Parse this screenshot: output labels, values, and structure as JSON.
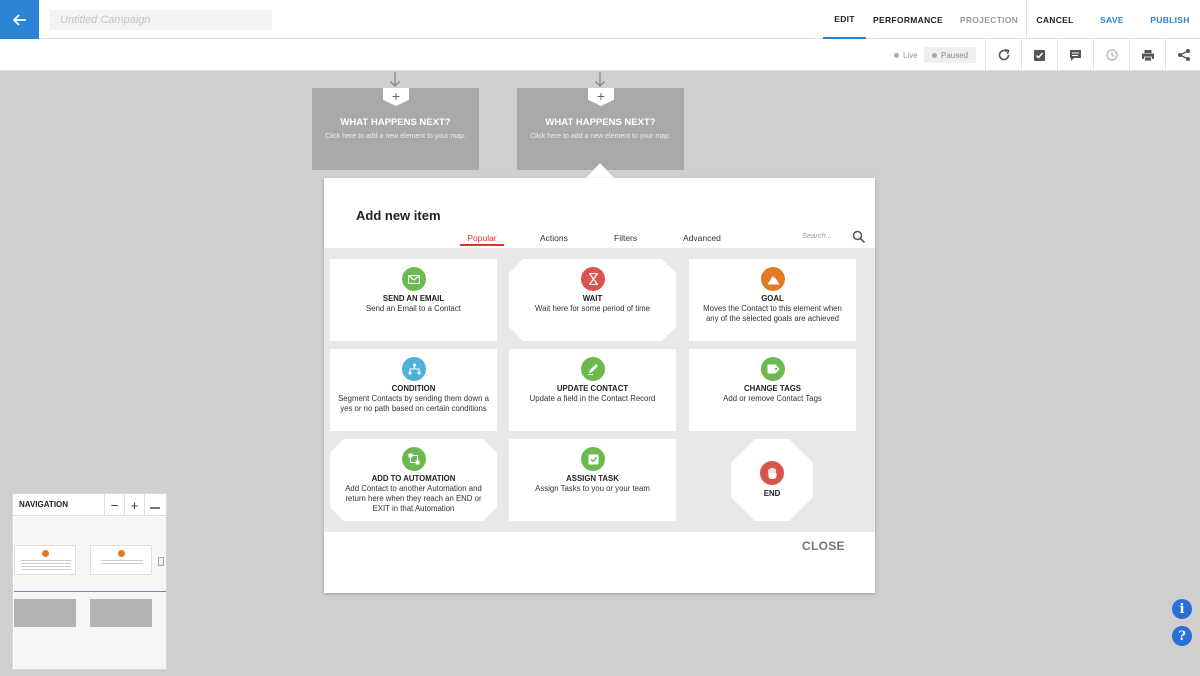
{
  "header": {
    "title_placeholder": "Untitled Campaign",
    "nav": {
      "edit": "EDIT",
      "performance": "PERFORMANCE",
      "projection": "PROJECTION",
      "cancel": "CANCEL",
      "save": "SAVE",
      "publish": "PUBLISH"
    },
    "accent_color": "#2b83d6"
  },
  "toolbar": {
    "status_live": "Live",
    "status_paused": "Paused",
    "icons": [
      "refresh-icon",
      "checklist-icon",
      "notes-icon",
      "history-icon",
      "print-icon",
      "share-icon"
    ]
  },
  "canvas": {
    "nodes": [
      {
        "title": "WHAT HAPPENS NEXT?",
        "subtitle": "Click here to add a new element to your map."
      },
      {
        "title": "WHAT HAPPENS NEXT?",
        "subtitle": "Click here to add a new element to your map."
      }
    ]
  },
  "modal": {
    "title": "Add new item",
    "tabs": [
      "Popular",
      "Actions",
      "Filters",
      "Advanced"
    ],
    "active_tab": "Popular",
    "search_placeholder": "Search...",
    "items": [
      {
        "title": "SEND AN EMAIL",
        "desc": "Send an Email to a Contact",
        "icon": "email-icon",
        "color": "#6cba4f"
      },
      {
        "title": "WAIT",
        "desc": "Wait here for some period of time",
        "icon": "hourglass-icon",
        "color": "#d9534f"
      },
      {
        "title": "GOAL",
        "desc": "Moves the Contact to this element when any of the selected goals are achieved",
        "icon": "goal-flag-icon",
        "color": "#e07b24"
      },
      {
        "title": "CONDITION",
        "desc": "Segment Contacts by sending them down a yes or no path based on certain conditions",
        "icon": "branch-icon",
        "color": "#4fb0d8"
      },
      {
        "title": "UPDATE CONTACT",
        "desc": "Update a field in the Contact Record",
        "icon": "edit-contact-icon",
        "color": "#6cba4f"
      },
      {
        "title": "CHANGE TAGS",
        "desc": "Add or remove Contact Tags",
        "icon": "tag-icon",
        "color": "#6cba4f"
      },
      {
        "title": "ADD TO AUTOMATION",
        "desc": "Add Contact to another Automation and return here when they reach an END or EXIT in that Automation",
        "icon": "automation-icon",
        "color": "#6cba4f"
      },
      {
        "title": "ASSIGN TASK",
        "desc": "Assign Tasks to you or your team",
        "icon": "task-icon",
        "color": "#6cba4f"
      },
      {
        "title": "END",
        "desc": "",
        "icon": "stop-hand-icon",
        "color": "#d9534f"
      }
    ],
    "close_label": "CLOSE"
  },
  "navigation": {
    "title": "NAVIGATION",
    "minus": "−",
    "plus": "+"
  },
  "help": {
    "info": "i",
    "question": "?"
  }
}
